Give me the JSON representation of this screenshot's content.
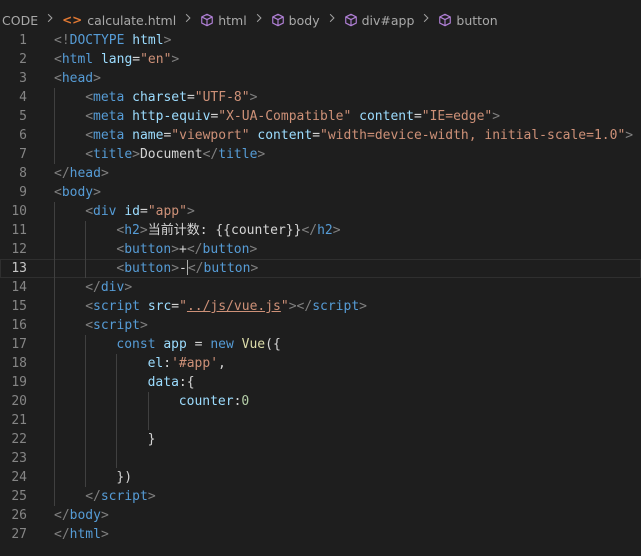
{
  "breadcrumb": [
    {
      "label": "CODE",
      "icon": "none"
    },
    {
      "label": "calculate.html",
      "icon": "html-file-icon"
    },
    {
      "label": "html",
      "icon": "element-icon"
    },
    {
      "label": "body",
      "icon": "element-icon"
    },
    {
      "label": "div#app",
      "icon": "element-icon"
    },
    {
      "label": "button",
      "icon": "element-icon"
    }
  ],
  "editor": {
    "current_line": 13,
    "lines": [
      {
        "n": "1",
        "indent": 0,
        "tokens": [
          [
            "tag",
            "<!"
          ],
          [
            "name",
            "DOCTYPE"
          ],
          [
            "text",
            " "
          ],
          [
            "attr",
            "html"
          ],
          [
            "tag",
            ">"
          ]
        ]
      },
      {
        "n": "2",
        "indent": 0,
        "tokens": [
          [
            "tag",
            "<"
          ],
          [
            "name",
            "html"
          ],
          [
            "text",
            " "
          ],
          [
            "attr",
            "lang"
          ],
          [
            "text",
            "="
          ],
          [
            "str",
            "\"en\""
          ],
          [
            "tag",
            ">"
          ]
        ]
      },
      {
        "n": "3",
        "indent": 0,
        "tokens": [
          [
            "tag",
            "<"
          ],
          [
            "name",
            "head"
          ],
          [
            "tag",
            ">"
          ]
        ]
      },
      {
        "n": "4",
        "indent": 1,
        "tokens": [
          [
            "tag",
            "<"
          ],
          [
            "name",
            "meta"
          ],
          [
            "text",
            " "
          ],
          [
            "attr",
            "charset"
          ],
          [
            "text",
            "="
          ],
          [
            "str",
            "\"UTF-8\""
          ],
          [
            "tag",
            ">"
          ]
        ]
      },
      {
        "n": "5",
        "indent": 1,
        "tokens": [
          [
            "tag",
            "<"
          ],
          [
            "name",
            "meta"
          ],
          [
            "text",
            " "
          ],
          [
            "attr",
            "http-equiv"
          ],
          [
            "text",
            "="
          ],
          [
            "str",
            "\"X-UA-Compatible\""
          ],
          [
            "text",
            " "
          ],
          [
            "attr",
            "content"
          ],
          [
            "text",
            "="
          ],
          [
            "str",
            "\"IE=edge\""
          ],
          [
            "tag",
            ">"
          ]
        ]
      },
      {
        "n": "6",
        "indent": 1,
        "tokens": [
          [
            "tag",
            "<"
          ],
          [
            "name",
            "meta"
          ],
          [
            "text",
            " "
          ],
          [
            "attr",
            "name"
          ],
          [
            "text",
            "="
          ],
          [
            "str",
            "\"viewport\""
          ],
          [
            "text",
            " "
          ],
          [
            "attr",
            "content"
          ],
          [
            "text",
            "="
          ],
          [
            "str",
            "\"width=device-width, initial-scale=1.0\""
          ],
          [
            "tag",
            ">"
          ]
        ]
      },
      {
        "n": "7",
        "indent": 1,
        "tokens": [
          [
            "tag",
            "<"
          ],
          [
            "name",
            "title"
          ],
          [
            "tag",
            ">"
          ],
          [
            "text",
            "Document"
          ],
          [
            "tag",
            "</"
          ],
          [
            "name",
            "title"
          ],
          [
            "tag",
            ">"
          ]
        ]
      },
      {
        "n": "8",
        "indent": 0,
        "tokens": [
          [
            "tag",
            "</"
          ],
          [
            "name",
            "head"
          ],
          [
            "tag",
            ">"
          ]
        ]
      },
      {
        "n": "9",
        "indent": 0,
        "tokens": [
          [
            "tag",
            "<"
          ],
          [
            "name",
            "body"
          ],
          [
            "tag",
            ">"
          ]
        ]
      },
      {
        "n": "10",
        "indent": 1,
        "tokens": [
          [
            "tag",
            "<"
          ],
          [
            "name",
            "div"
          ],
          [
            "text",
            " "
          ],
          [
            "attr",
            "id"
          ],
          [
            "text",
            "="
          ],
          [
            "str",
            "\"app\""
          ],
          [
            "tag",
            ">"
          ]
        ]
      },
      {
        "n": "11",
        "indent": 2,
        "tokens": [
          [
            "tag",
            "<"
          ],
          [
            "name",
            "h2"
          ],
          [
            "tag",
            ">"
          ],
          [
            "text",
            "当前计数: {{counter}}"
          ],
          [
            "tag",
            "</"
          ],
          [
            "name",
            "h2"
          ],
          [
            "tag",
            ">"
          ]
        ]
      },
      {
        "n": "12",
        "indent": 2,
        "tokens": [
          [
            "tag",
            "<"
          ],
          [
            "name",
            "button"
          ],
          [
            "tag",
            ">"
          ],
          [
            "text",
            "+"
          ],
          [
            "tag",
            "</"
          ],
          [
            "name",
            "button"
          ],
          [
            "tag",
            ">"
          ]
        ]
      },
      {
        "n": "13",
        "indent": 2,
        "tokens": [
          [
            "tag",
            "<"
          ],
          [
            "name",
            "button"
          ],
          [
            "tag",
            ">"
          ],
          [
            "text",
            "-"
          ],
          [
            "cursor",
            ""
          ],
          [
            "tag",
            "</"
          ],
          [
            "name",
            "button"
          ],
          [
            "tag",
            ">"
          ]
        ]
      },
      {
        "n": "14",
        "indent": 1,
        "tokens": [
          [
            "tag",
            "</"
          ],
          [
            "name",
            "div"
          ],
          [
            "tag",
            ">"
          ]
        ]
      },
      {
        "n": "15",
        "indent": 1,
        "tokens": [
          [
            "tag",
            "<"
          ],
          [
            "name",
            "script"
          ],
          [
            "text",
            " "
          ],
          [
            "attr",
            "src"
          ],
          [
            "text",
            "="
          ],
          [
            "str",
            "\""
          ],
          [
            "stru",
            "../js/vue.js"
          ],
          [
            "str",
            "\""
          ],
          [
            "tag",
            "></"
          ],
          [
            "name",
            "script"
          ],
          [
            "tag",
            ">"
          ]
        ]
      },
      {
        "n": "16",
        "indent": 1,
        "tokens": [
          [
            "tag",
            "<"
          ],
          [
            "name",
            "script"
          ],
          [
            "tag",
            ">"
          ]
        ]
      },
      {
        "n": "17",
        "indent": 2,
        "tokens": [
          [
            "kw",
            "const"
          ],
          [
            "text",
            " "
          ],
          [
            "var",
            "app"
          ],
          [
            "text",
            " = "
          ],
          [
            "kw",
            "new"
          ],
          [
            "text",
            " "
          ],
          [
            "fn",
            "Vue"
          ],
          [
            "text",
            "({"
          ]
        ]
      },
      {
        "n": "18",
        "indent": 3,
        "tokens": [
          [
            "prop",
            "el"
          ],
          [
            "text",
            ":"
          ],
          [
            "str",
            "'#app'"
          ],
          [
            "text",
            ","
          ]
        ]
      },
      {
        "n": "19",
        "indent": 3,
        "tokens": [
          [
            "prop",
            "data"
          ],
          [
            "text",
            ":{"
          ]
        ]
      },
      {
        "n": "20",
        "indent": 4,
        "tokens": [
          [
            "prop",
            "counter"
          ],
          [
            "text",
            ":"
          ],
          [
            "num",
            "0"
          ]
        ]
      },
      {
        "n": "21",
        "indent": 4,
        "tokens": []
      },
      {
        "n": "22",
        "indent": 3,
        "tokens": [
          [
            "text",
            "}"
          ]
        ]
      },
      {
        "n": "23",
        "indent": 3,
        "tokens": []
      },
      {
        "n": "24",
        "indent": 2,
        "tokens": [
          [
            "text",
            "})"
          ]
        ]
      },
      {
        "n": "25",
        "indent": 1,
        "tokens": [
          [
            "tag",
            "</"
          ],
          [
            "name",
            "script"
          ],
          [
            "tag",
            ">"
          ]
        ]
      },
      {
        "n": "26",
        "indent": 0,
        "tokens": [
          [
            "tag",
            "</"
          ],
          [
            "name",
            "body"
          ],
          [
            "tag",
            ">"
          ]
        ]
      },
      {
        "n": "27",
        "indent": 0,
        "tokens": [
          [
            "tag",
            "</"
          ],
          [
            "name",
            "html"
          ],
          [
            "tag",
            ">"
          ]
        ]
      }
    ]
  }
}
